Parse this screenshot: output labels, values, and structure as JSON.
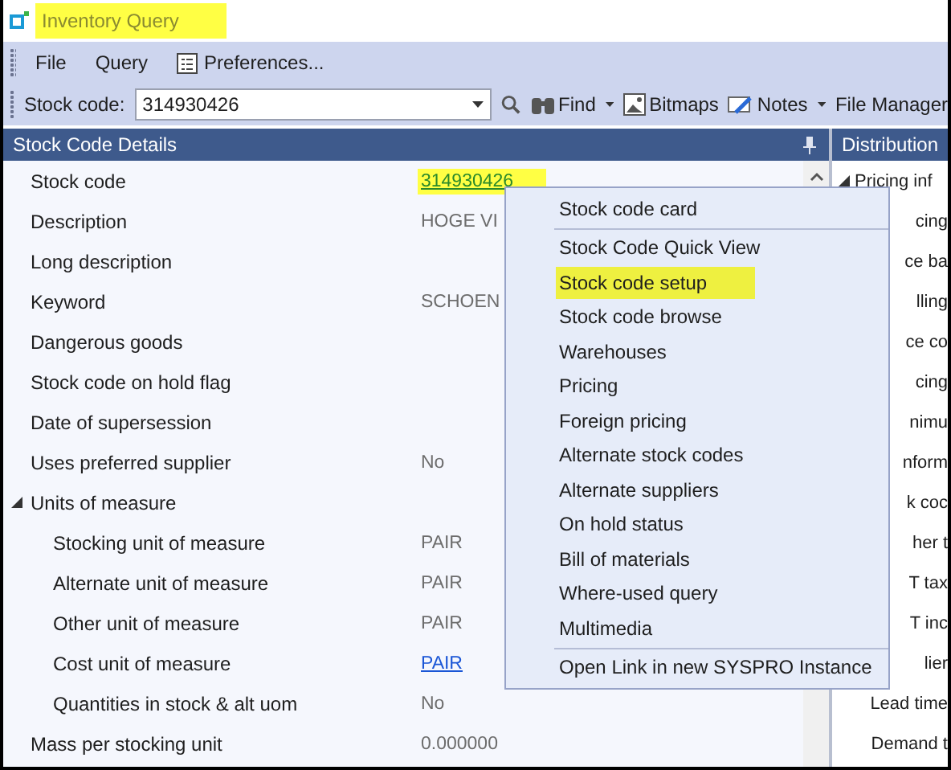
{
  "window": {
    "title": "Inventory Query",
    "title_highlighted": true
  },
  "menu_bar": [
    {
      "label": "File",
      "kind": "text"
    },
    {
      "label": "Query",
      "kind": "text"
    },
    {
      "label": "Preferences...",
      "kind": "icon"
    }
  ],
  "toolbar": {
    "stock_code_label": "Stock code:",
    "stock_code_value": "314930426",
    "find": "Find",
    "bitmaps": "Bitmaps",
    "notes": "Notes",
    "file_manager": "File Manager"
  },
  "details_panel": {
    "title": "Stock Code Details",
    "rows": [
      {
        "label": "Stock code",
        "value": "314930426",
        "kind": "link",
        "highlighted": true
      },
      {
        "label": "Description",
        "value": "HOGE VI",
        "kind": "plain"
      },
      {
        "label": "Long description",
        "kind": "plain"
      },
      {
        "label": "Keyword",
        "value": "SCHOEN",
        "kind": "plain"
      },
      {
        "label": "Dangerous goods",
        "kind": "plain"
      },
      {
        "label": "Stock code on hold flag",
        "kind": "plain"
      },
      {
        "label": "Date of supersession",
        "kind": "plain"
      },
      {
        "label": "Uses preferred supplier",
        "value": "No",
        "kind": "plain"
      },
      {
        "label": "Units of measure",
        "kind": "group",
        "expanded": true,
        "children": [
          {
            "label": "Stocking unit of measure",
            "value": "PAIR",
            "kind": "plain"
          },
          {
            "label": "Alternate unit of measure",
            "value": "PAIR",
            "kind": "plain"
          },
          {
            "label": "Other unit of measure",
            "value": "PAIR",
            "kind": "plain"
          },
          {
            "label": "Cost unit of measure",
            "value": "PAIR",
            "kind": "link_blue"
          },
          {
            "label": "Quantities in stock & alt uom",
            "value": "No",
            "kind": "plain"
          }
        ]
      },
      {
        "label": "Mass per stocking unit",
        "value": "0.000000",
        "kind": "plain"
      }
    ]
  },
  "distribution_panel": {
    "title": "Distribution",
    "rows": [
      {
        "label": "Pricing inf",
        "kind": "group",
        "expanded": true
      },
      {
        "label": "cing",
        "kind": "plain"
      },
      {
        "label": "ce ba",
        "kind": "plain"
      },
      {
        "label": "lling",
        "kind": "plain"
      },
      {
        "label": "ce co",
        "kind": "plain"
      },
      {
        "label": "cing",
        "kind": "plain"
      },
      {
        "label": "nimu",
        "kind": "plain"
      },
      {
        "label": "nform",
        "kind": "plain"
      },
      {
        "label": "k coc",
        "kind": "plain"
      },
      {
        "label": "her t",
        "kind": "plain"
      },
      {
        "label": "T tax",
        "kind": "plain"
      },
      {
        "label": "T inc",
        "kind": "plain"
      },
      {
        "label": "lier",
        "kind": "plain"
      },
      {
        "label": "Lead time",
        "kind": "plain"
      },
      {
        "label": "Demand t",
        "kind": "plain"
      }
    ]
  },
  "context_menu": [
    {
      "label": "Stock code card",
      "separator_after": true,
      "highlighted": false
    },
    {
      "label": "Stock Code Quick View",
      "separator_after": false,
      "highlighted": false
    },
    {
      "label": "Stock code setup",
      "separator_after": false,
      "highlighted": true
    },
    {
      "label": "Stock code browse",
      "separator_after": false,
      "highlighted": false
    },
    {
      "label": "Warehouses",
      "separator_after": false,
      "highlighted": false
    },
    {
      "label": "Pricing",
      "separator_after": false,
      "highlighted": false
    },
    {
      "label": "Foreign pricing",
      "separator_after": false,
      "highlighted": false
    },
    {
      "label": "Alternate stock codes",
      "separator_after": false,
      "highlighted": false
    },
    {
      "label": "Alternate suppliers",
      "separator_after": false,
      "highlighted": false
    },
    {
      "label": "On hold status",
      "separator_after": false,
      "highlighted": false
    },
    {
      "label": "Bill of materials",
      "separator_after": false,
      "highlighted": false
    },
    {
      "label": "Where-used query",
      "separator_after": false,
      "highlighted": false
    },
    {
      "label": "Multimedia",
      "separator_after": true,
      "highlighted": false
    },
    {
      "label": "Open Link in new SYSPRO Instance",
      "separator_after": false,
      "highlighted": false
    }
  ]
}
